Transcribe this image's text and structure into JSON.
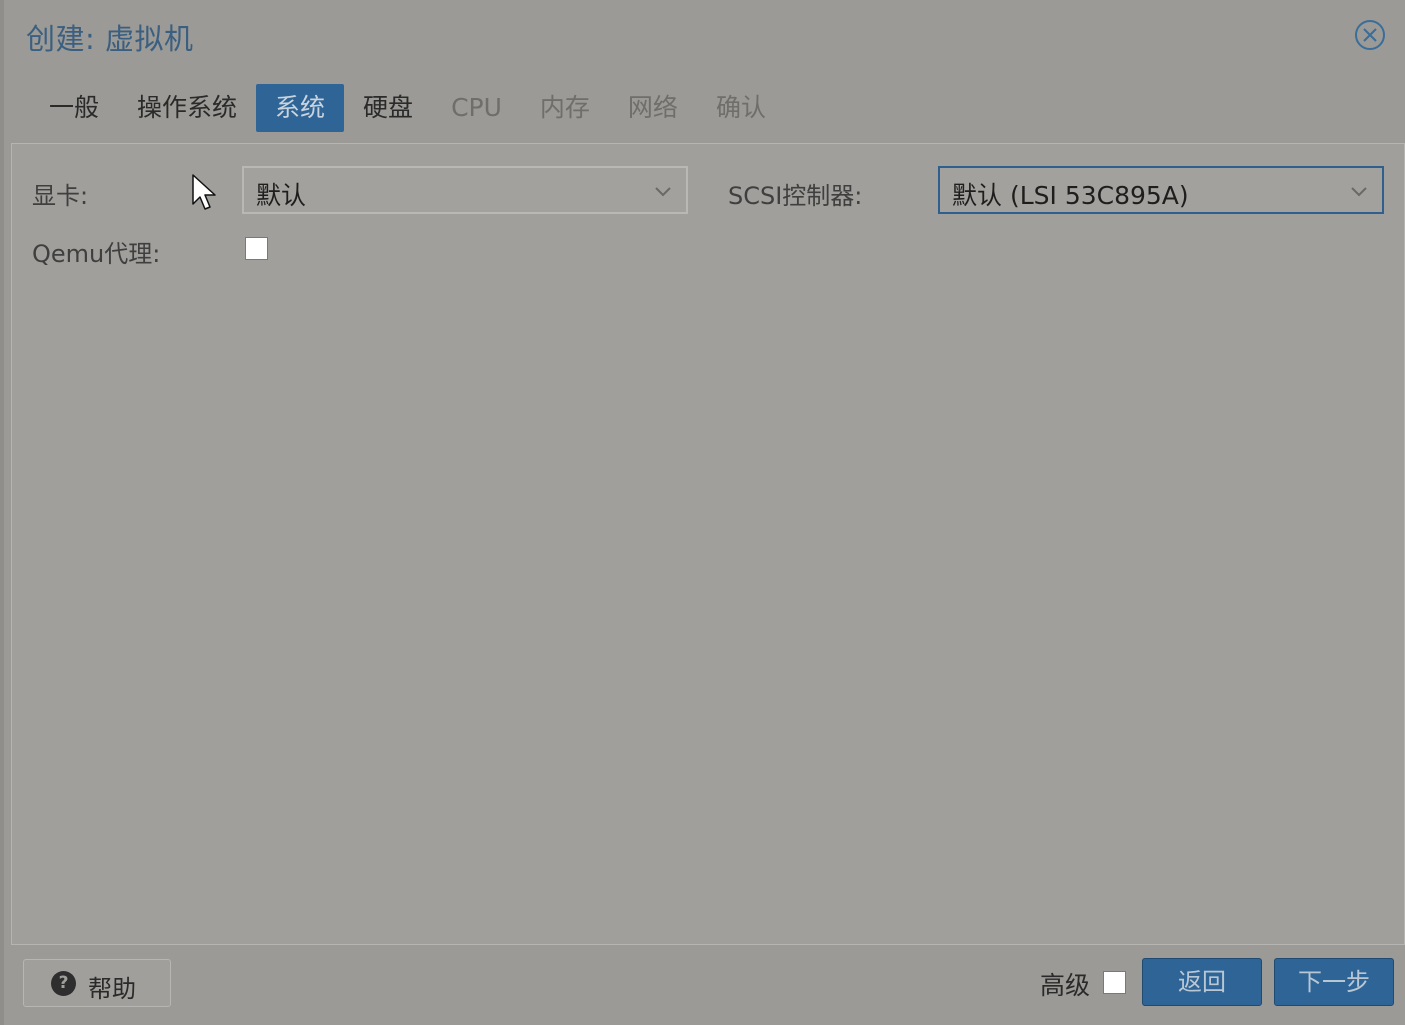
{
  "dialog": {
    "title": "创建: 虚拟机"
  },
  "tabs": [
    {
      "label": "一般",
      "state": "enabled"
    },
    {
      "label": "操作系统",
      "state": "enabled"
    },
    {
      "label": "系统",
      "state": "active"
    },
    {
      "label": "硬盘",
      "state": "enabled"
    },
    {
      "label": "CPU",
      "state": "disabled"
    },
    {
      "label": "内存",
      "state": "disabled"
    },
    {
      "label": "网络",
      "state": "disabled"
    },
    {
      "label": "确认",
      "state": "disabled"
    }
  ],
  "form": {
    "graphics_card_label": "显卡:",
    "graphics_card_value": "默认",
    "scsi_controller_label": "SCSI控制器:",
    "scsi_controller_value": "默认 (LSI 53C895A)",
    "qemu_agent_label": "Qemu代理:",
    "qemu_agent_checked": false
  },
  "footer": {
    "help_label": "帮助",
    "advanced_label": "高级",
    "advanced_checked": false,
    "back_label": "返回",
    "next_label": "下一步"
  },
  "icons": {
    "close": "close-circle-icon",
    "help": "question-circle-icon",
    "dropdown": "chevron-down-icon",
    "cursor": "mouse-pointer-icon"
  },
  "colors": {
    "accent": "#2f6496",
    "title": "#3a5f80"
  }
}
